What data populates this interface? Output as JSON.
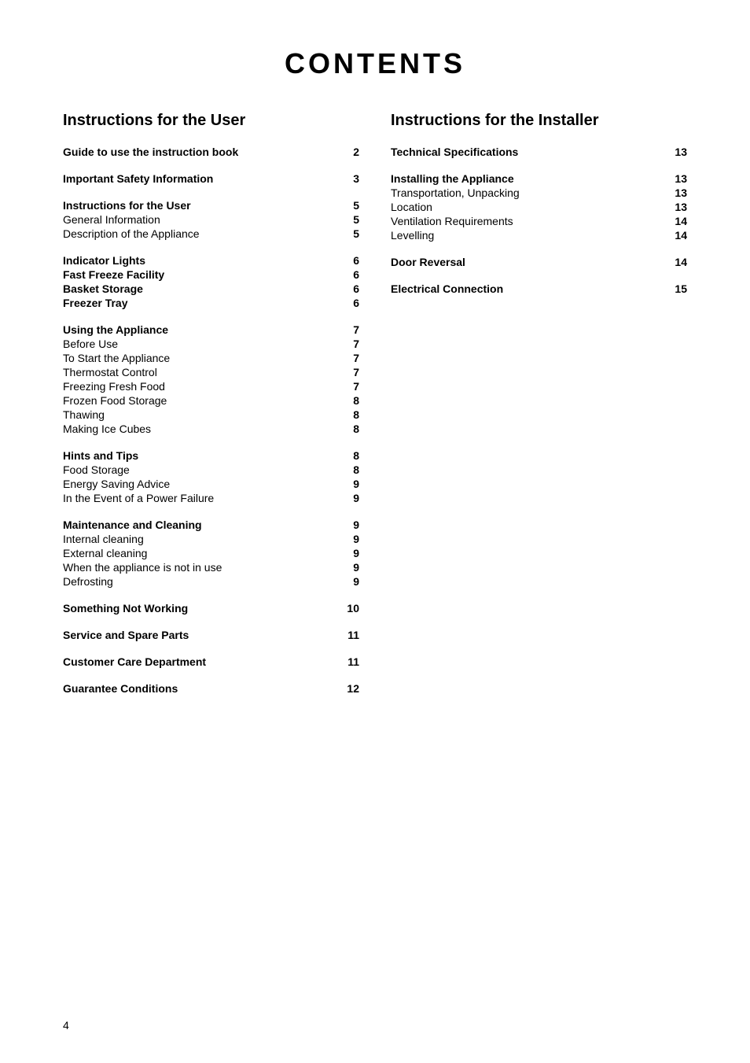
{
  "page": {
    "title": "CONTENTS",
    "page_number": "4"
  },
  "left_column": {
    "heading": "Instructions for the User",
    "groups": [
      {
        "entries": [
          {
            "label": "Guide to use the instruction book",
            "page": "2",
            "bold": true
          }
        ]
      },
      {
        "entries": [
          {
            "label": "Important Safety Information",
            "page": "3",
            "bold": true
          }
        ]
      },
      {
        "entries": [
          {
            "label": "Instructions for the User",
            "page": "5",
            "bold": true
          },
          {
            "label": "General Information",
            "page": "5",
            "bold": false
          },
          {
            "label": "Description of the Appliance",
            "page": "5",
            "bold": false
          }
        ]
      },
      {
        "entries": [
          {
            "label": "Indicator Lights",
            "page": "6",
            "bold": true
          },
          {
            "label": "Fast Freeze Facility",
            "page": "6",
            "bold": true
          },
          {
            "label": "Basket Storage",
            "page": "6",
            "bold": true
          },
          {
            "label": "Freezer Tray",
            "page": "6",
            "bold": true
          }
        ]
      },
      {
        "entries": [
          {
            "label": "Using the Appliance",
            "page": "7",
            "bold": true
          },
          {
            "label": "Before Use",
            "page": "7",
            "bold": false
          },
          {
            "label": "To Start the Appliance",
            "page": "7",
            "bold": false
          },
          {
            "label": "Thermostat Control",
            "page": "7",
            "bold": false
          },
          {
            "label": "Freezing Fresh Food",
            "page": "7",
            "bold": false
          },
          {
            "label": "Frozen Food Storage",
            "page": "8",
            "bold": false
          },
          {
            "label": "Thawing",
            "page": "8",
            "bold": false
          },
          {
            "label": "Making Ice Cubes",
            "page": "8",
            "bold": false
          }
        ]
      },
      {
        "entries": [
          {
            "label": "Hints and Tips",
            "page": "8",
            "bold": true
          },
          {
            "label": "Food Storage",
            "page": "8",
            "bold": false
          },
          {
            "label": "Energy Saving Advice",
            "page": "9",
            "bold": false
          },
          {
            "label": "In the Event of a Power Failure",
            "page": "9",
            "bold": false
          }
        ]
      },
      {
        "entries": [
          {
            "label": "Maintenance and Cleaning",
            "page": "9",
            "bold": true
          },
          {
            "label": "Internal cleaning",
            "page": "9",
            "bold": false
          },
          {
            "label": "External cleaning",
            "page": "9",
            "bold": false
          },
          {
            "label": "When the appliance is not in use",
            "page": "9",
            "bold": false
          },
          {
            "label": "Defrosting",
            "page": "9",
            "bold": false
          }
        ]
      },
      {
        "entries": [
          {
            "label": "Something Not Working",
            "page": "10",
            "bold": true
          }
        ]
      },
      {
        "entries": [
          {
            "label": "Service and Spare Parts",
            "page": "11",
            "bold": true
          }
        ]
      },
      {
        "entries": [
          {
            "label": "Customer Care Department",
            "page": "11",
            "bold": true
          }
        ]
      },
      {
        "entries": [
          {
            "label": "Guarantee Conditions",
            "page": "12",
            "bold": true
          }
        ]
      }
    ]
  },
  "right_column": {
    "heading": "Instructions for the Installer",
    "groups": [
      {
        "entries": [
          {
            "label": "Technical Specifications",
            "page": "13",
            "bold": true
          }
        ]
      },
      {
        "entries": [
          {
            "label": "Installing the Appliance",
            "page": "13",
            "bold": true
          },
          {
            "label": "Transportation, Unpacking",
            "page": "13",
            "bold": false
          },
          {
            "label": "Location",
            "page": "13",
            "bold": false
          },
          {
            "label": "Ventilation Requirements",
            "page": "14",
            "bold": false
          },
          {
            "label": "Levelling",
            "page": "14",
            "bold": false
          }
        ]
      },
      {
        "entries": [
          {
            "label": "Door Reversal",
            "page": "14",
            "bold": true
          }
        ]
      },
      {
        "entries": [
          {
            "label": "Electrical Connection",
            "page": "15",
            "bold": true
          }
        ]
      }
    ]
  }
}
